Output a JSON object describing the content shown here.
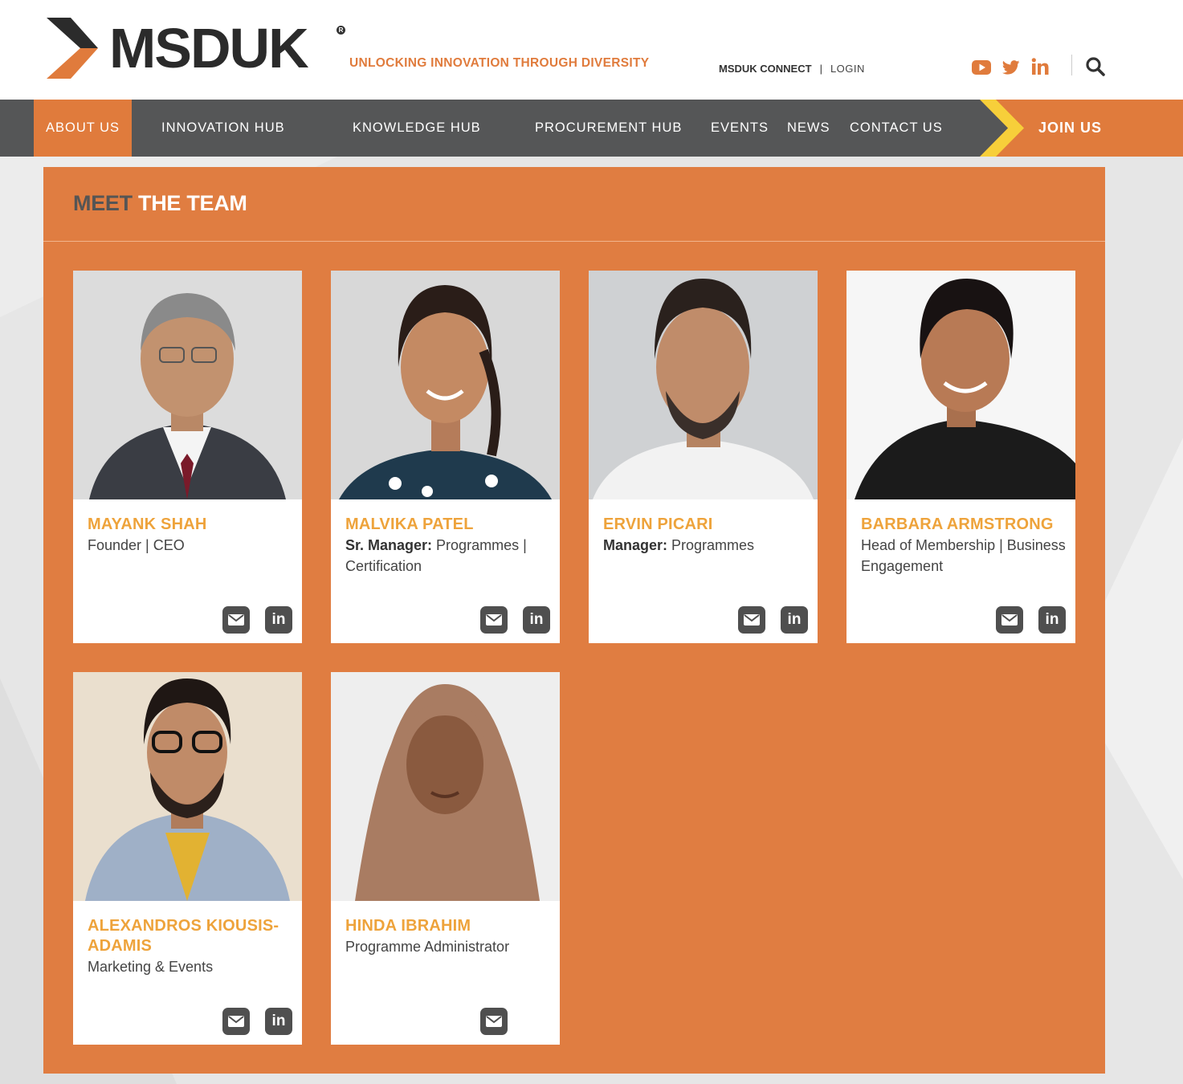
{
  "brand": {
    "logo_text": "MSDUK",
    "registered_mark": "R",
    "tagline": "UNLOCKING INNOVATION THROUGH DIVERSITY",
    "accent_color": "#e07b3c",
    "dark_color": "#555657",
    "chevron_yellow": "#f7cf3a"
  },
  "top_links": {
    "connect": "MSDUK CONNECT",
    "separator": "|",
    "login": "LOGIN"
  },
  "social_icons": [
    "youtube-icon",
    "twitter-icon",
    "linkedin-icon",
    "search-icon"
  ],
  "nav": {
    "items": [
      {
        "label": "ABOUT US",
        "active": true
      },
      {
        "label": "INNOVATION HUB",
        "active": false
      },
      {
        "label": "KNOWLEDGE HUB",
        "active": false
      },
      {
        "label": "PROCUREMENT HUB",
        "active": false
      },
      {
        "label": "EVENTS",
        "active": false
      },
      {
        "label": "NEWS",
        "active": false
      },
      {
        "label": "CONTACT US",
        "active": false
      }
    ],
    "join": "JOIN US"
  },
  "section": {
    "title_part1": "MEET",
    "title_part2": "THE TEAM"
  },
  "team": [
    {
      "name": "MAYANK SHAH",
      "role_bold": "",
      "role": "Founder | CEO",
      "email_icon": "envelope-icon",
      "linkedin": "in"
    },
    {
      "name": "MALVIKA PATEL",
      "role_bold": "Sr. Manager:",
      "role": " Programmes | Certification",
      "email_icon": "envelope-icon",
      "linkedin": "in"
    },
    {
      "name": "ERVIN PICARI",
      "role_bold": "Manager:",
      "role": " Programmes",
      "email_icon": "envelope-icon",
      "linkedin": "in"
    },
    {
      "name": "BARBARA ARMSTRONG",
      "role_bold": "",
      "role": "Head of Membership | Business Engagement",
      "email_icon": "envelope-icon",
      "linkedin": "in"
    },
    {
      "name": "ALEXANDROS KIOUSIS-ADAMIS",
      "role_bold": "",
      "role": "Marketing & Events",
      "email_icon": "envelope-icon",
      "linkedin": "in"
    },
    {
      "name": "HINDA IBRAHIM",
      "role_bold": "",
      "role": "Programme Administrator",
      "email_icon": "envelope-icon"
    }
  ]
}
